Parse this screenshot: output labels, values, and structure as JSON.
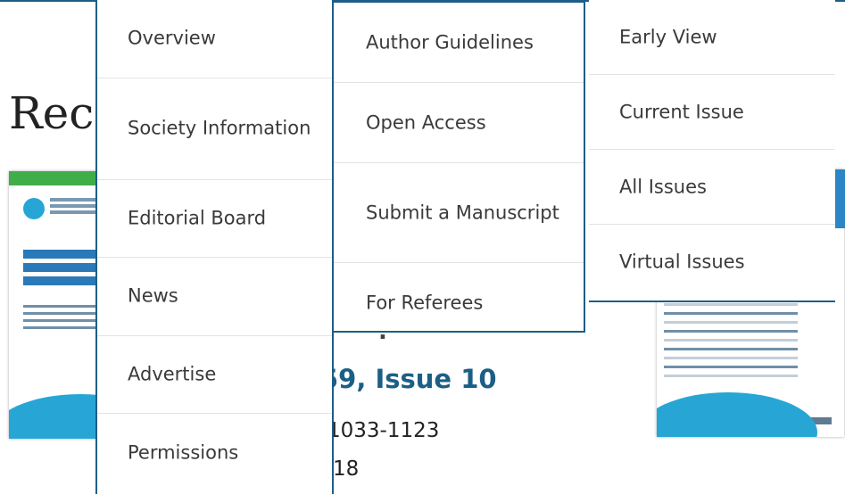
{
  "page": {
    "heading": "Rec",
    "issue_volume": "59, Issue 10",
    "issue_pages": "1033-1123",
    "issue_date": "18",
    "issue_partial": "."
  },
  "menu": {
    "about_items": [
      {
        "label": "Overview"
      },
      {
        "label": "Society Information"
      },
      {
        "label": "Editorial Board"
      },
      {
        "label": "News"
      },
      {
        "label": "Advertise"
      },
      {
        "label": "Permissions"
      }
    ],
    "author_items": [
      {
        "label": "Author Guidelines"
      },
      {
        "label": "Open Access"
      },
      {
        "label": "Submit a Manuscript"
      },
      {
        "label": "For Referees"
      }
    ],
    "issue_items": [
      {
        "label": "Early View"
      },
      {
        "label": "Current Issue"
      },
      {
        "label": "All Issues"
      },
      {
        "label": "Virtual Issues"
      }
    ]
  },
  "colors": {
    "accent": "#1d5e86",
    "link": "#1c5f86",
    "cover_blue": "#27a6d6",
    "cover_green": "#3fae49"
  }
}
